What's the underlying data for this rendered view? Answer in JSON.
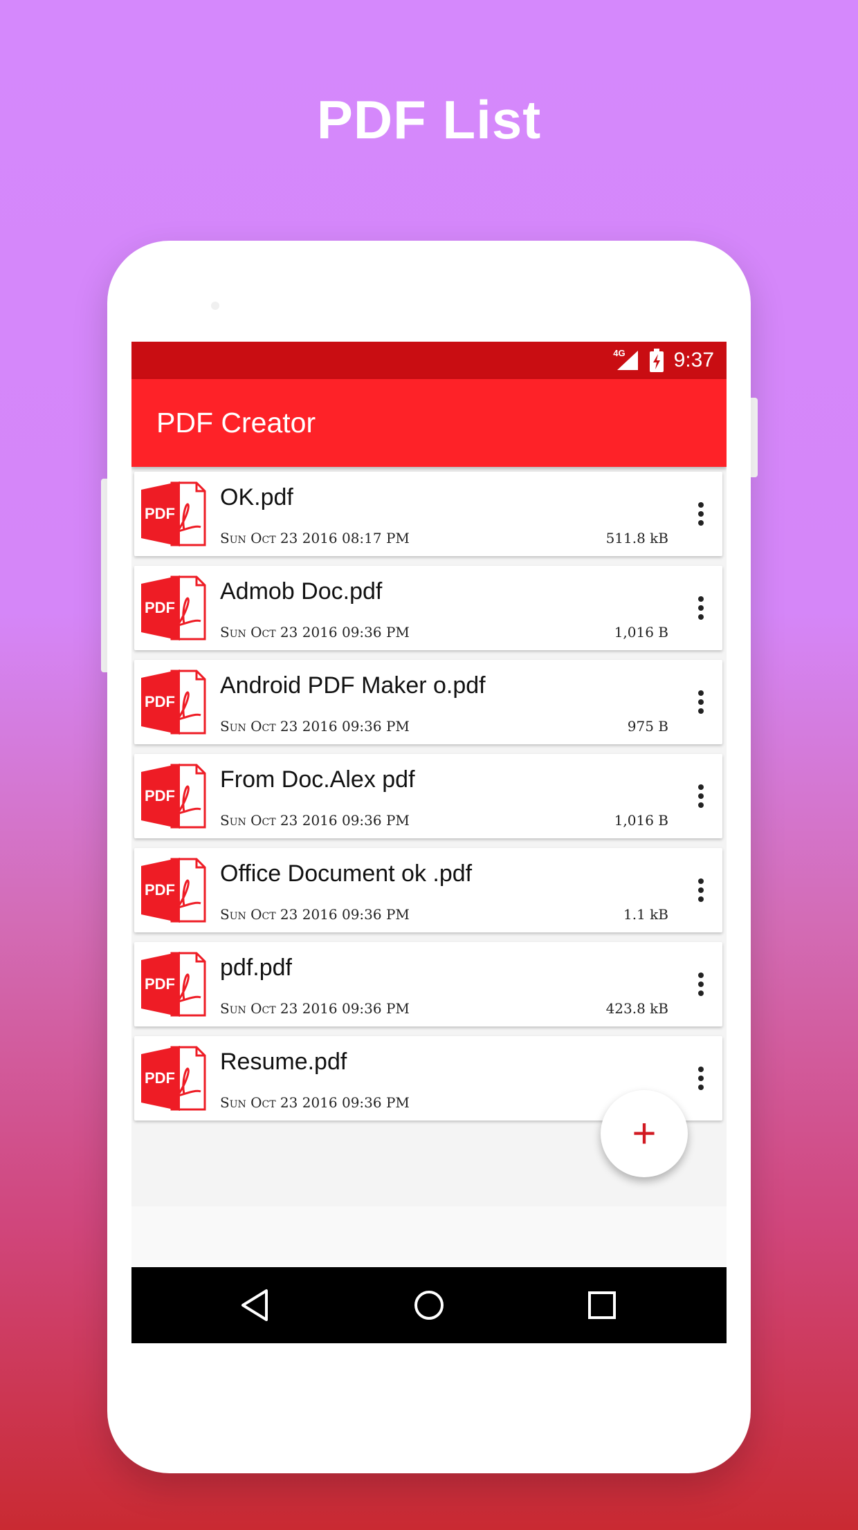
{
  "promo": {
    "title": "PDF List"
  },
  "status_bar": {
    "network": "4G",
    "time": "9:37"
  },
  "app_bar": {
    "title": "PDF Creator"
  },
  "colors": {
    "status_bar": "#c90d12",
    "app_bar": "#fe2228",
    "pdf_icon": "#ee1c25",
    "fab_plus": "#d11a22"
  },
  "icons": {
    "file": "pdf-file-icon",
    "more": "more-vert-icon",
    "fab": "plus-icon",
    "nav_back": "back-triangle-icon",
    "nav_home": "home-circle-icon",
    "nav_recent": "recent-square-icon"
  },
  "pdf_icon_label": "PDF",
  "files": [
    {
      "name": "OK.pdf",
      "date": "Sun Oct 23 2016 08:17 PM",
      "size": "511.8 kB"
    },
    {
      "name": "Admob Doc.pdf",
      "date": "Sun Oct 23 2016 09:36 PM",
      "size": "1,016 B"
    },
    {
      "name": "Android PDF Maker o.pdf",
      "date": "Sun Oct 23 2016 09:36 PM",
      "size": "975 B"
    },
    {
      "name": "From Doc.Alex pdf",
      "date": "Sun Oct 23 2016 09:36 PM",
      "size": "1,016 B"
    },
    {
      "name": "Office Document ok .pdf",
      "date": "Sun Oct 23 2016 09:36 PM",
      "size": "1.1 kB"
    },
    {
      "name": "pdf.pdf",
      "date": "Sun Oct 23 2016 09:36 PM",
      "size": "423.8 kB"
    },
    {
      "name": "Resume.pdf",
      "date": "Sun Oct 23 2016 09:36 PM",
      "size": ""
    }
  ],
  "fab": {
    "label": "+"
  }
}
